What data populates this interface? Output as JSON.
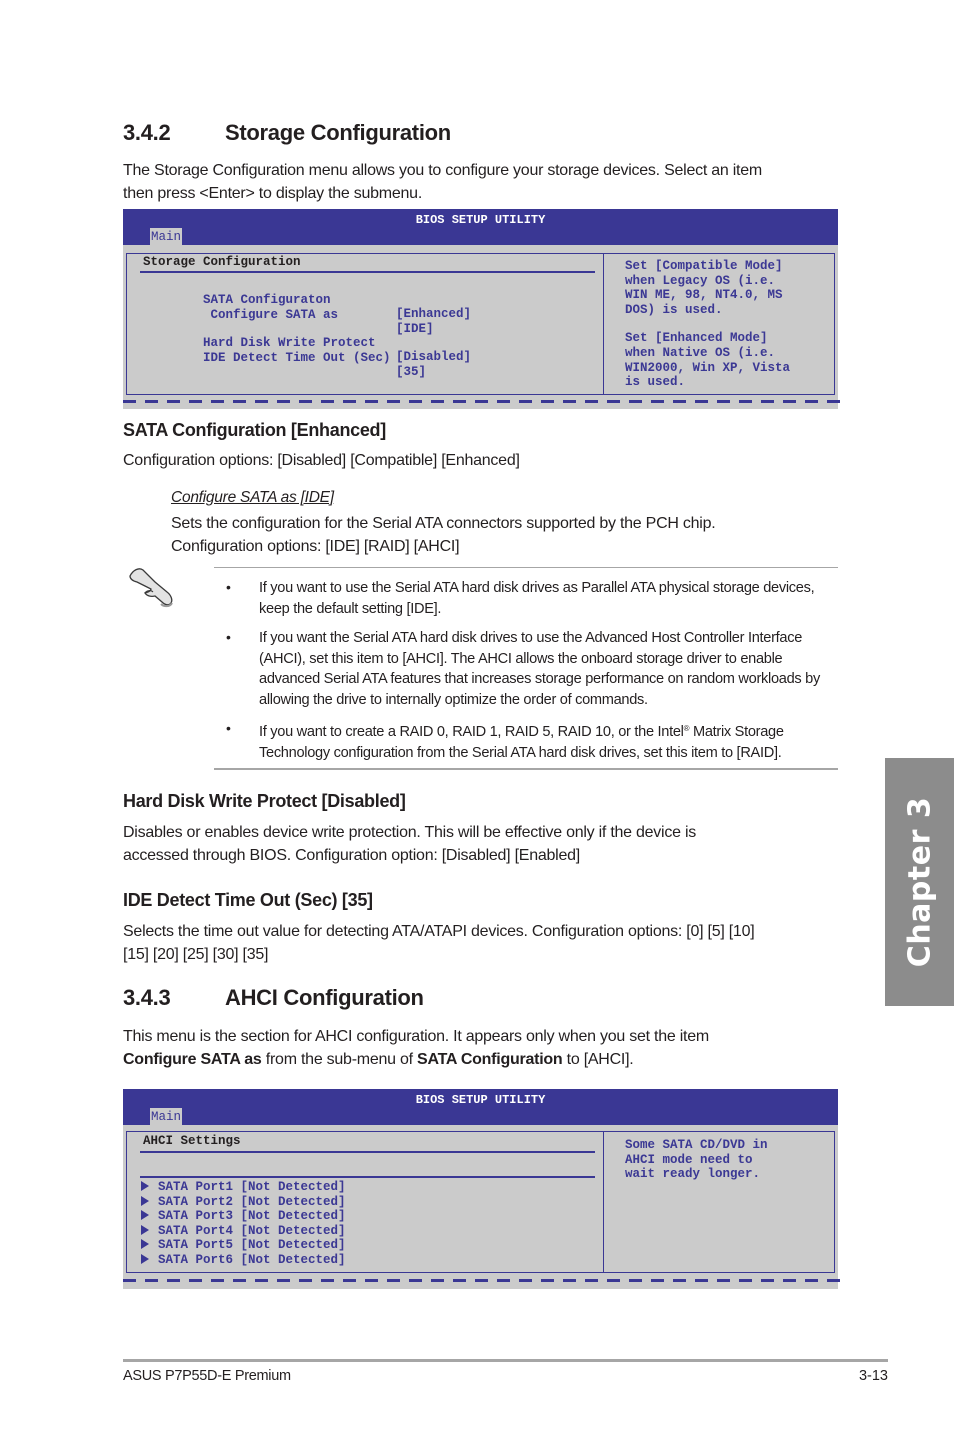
{
  "section_342": {
    "number": "3.4.2",
    "title": "Storage Configuration",
    "intro_line1": "The Storage Configuration menu allows you to configure your storage devices. Select an item",
    "intro_line2": "then press <Enter> to display the submenu."
  },
  "bios1": {
    "header_title": "BIOS SETUP UTILITY",
    "tab": "Main",
    "pane_title": "Storage Configuration",
    "items": [
      {
        "label": "SATA Configuraton",
        "value": "[Enhanced]"
      },
      {
        "label": " Configure SATA as",
        "value": "[IDE]"
      },
      {
        "label": "Hard Disk Write Protect",
        "value": "[Disabled]"
      },
      {
        "label": "IDE Detect Time Out (Sec)",
        "value": "[35]"
      }
    ],
    "help_lines": [
      "Set [Compatible Mode]",
      "when Legacy OS (i.e.",
      "WIN ME, 98, NT4.0, MS",
      "DOS) is used.",
      "",
      "Set [Enhanced Mode]",
      "when Native OS (i.e.",
      "WIN2000, Win XP, Vista",
      "is used."
    ]
  },
  "sata_config": {
    "heading": "SATA Configuration [Enhanced]",
    "options": "Configuration options: [Disabled] [Compatible] [Enhanced]",
    "sub_heading": "Configure SATA as [IDE]",
    "sub_line1": "Sets the configuration for the Serial ATA connectors supported by the PCH chip.",
    "sub_line2": "Configuration options: [IDE] [RAID] [AHCI]"
  },
  "note": {
    "icon": "hand-pointer-icon",
    "bullet": "•",
    "items": [
      {
        "text": "If you want to use the Serial ATA hard disk drives as Parallel ATA physical storage devices, keep the default setting [IDE]."
      },
      {
        "text": "If you want the Serial ATA hard disk drives to use the Advanced Host Controller Interface (AHCI), set this item to [AHCI]. The AHCI allows the onboard storage driver to enable advanced Serial ATA features that increases storage performance on random workloads by allowing the drive to internally optimize the order of commands."
      },
      {
        "text_before": "If you want to create a RAID 0, RAID 1, RAID 5, RAID 10, or the Intel",
        "sup": "®",
        "text_after": " Matrix Storage Technology configuration from the Serial ATA hard disk drives, set this item to [RAID]."
      }
    ]
  },
  "hdwp": {
    "heading": "Hard Disk Write Protect [Disabled]",
    "line1": "Disables or enables device write protection. This will be effective only if the device is",
    "line2": "accessed through BIOS. Configuration option: [Disabled] [Enabled]"
  },
  "ide_timeout": {
    "heading": "IDE Detect Time Out (Sec) [35]",
    "line1": "Selects the time out value for detecting ATA/ATAPI devices. Configuration options: [0] [5] [10]",
    "line2": "[15] [20] [25] [30] [35]"
  },
  "section_343": {
    "number": "3.4.3",
    "title": "AHCI Configuration",
    "line1": "This menu is the section for AHCI configuration. It appears only when you set the item",
    "line2_bold1": "Configure SATA as",
    "line2_mid": " from the sub-menu of ",
    "line2_bold2": "SATA Configuration",
    "line2_end": " to [AHCI]."
  },
  "bios2": {
    "header_title": "BIOS SETUP UTILITY",
    "tab": "Main",
    "pane_title": "AHCI Settings",
    "ports": [
      "SATA Port1 [Not Detected]",
      "SATA Port2 [Not Detected]",
      "SATA Port3 [Not Detected]",
      "SATA Port4 [Not Detected]",
      "SATA Port5 [Not Detected]",
      "SATA Port6 [Not Detected]"
    ],
    "help_lines": [
      "Some SATA CD/DVD in",
      "AHCI mode need to",
      "wait ready longer."
    ]
  },
  "chapter_tab": "Chapter 3",
  "footer": {
    "product": "ASUS P7P55D-E Premium",
    "page": "3-13"
  }
}
